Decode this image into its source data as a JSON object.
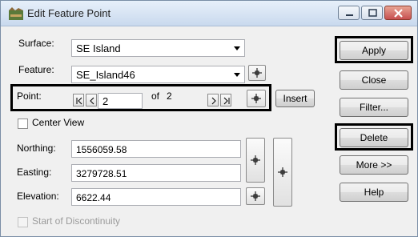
{
  "window": {
    "title": "Edit Feature Point",
    "controls": {
      "minimize": "minimize-icon",
      "maximize": "maximize-icon",
      "close": "close-icon"
    }
  },
  "form": {
    "surface_label": "Surface:",
    "surface_value": "SE Island",
    "feature_label": "Feature:",
    "feature_value": "SE_Island46",
    "point_label": "Point:",
    "point_value": "2",
    "point_of": "of",
    "point_total": "2",
    "insert_label": "Insert",
    "center_view_label": "Center View",
    "center_view_checked": false,
    "northing_label": "Northing:",
    "northing_value": "1556059.58",
    "easting_label": "Easting:",
    "easting_value": "3279728.51",
    "elevation_label": "Elevation:",
    "elevation_value": "6622.44",
    "discontinuity_label": "Start of Discontinuity",
    "discontinuity_checked": false
  },
  "buttons": {
    "apply": "Apply",
    "close": "Close",
    "filter": "Filter...",
    "delete": "Delete",
    "more": "More >>",
    "help": "Help"
  },
  "icons": {
    "nav": [
      "first-icon",
      "previous-icon",
      "next-icon",
      "last-icon"
    ],
    "pick": "crosshair-icon"
  },
  "colors": {
    "titlebar": "#c9d9ee",
    "close_button": "#c75050",
    "highlight": "#000000"
  }
}
